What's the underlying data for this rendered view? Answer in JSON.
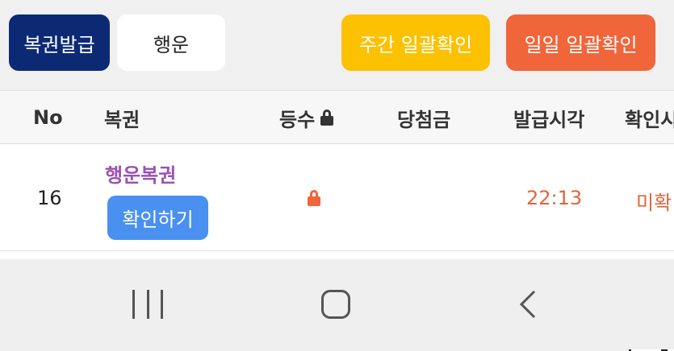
{
  "toolbar": {
    "issue_label": "복권발급",
    "luck_label": "행운",
    "weekly_label": "주간 일괄확인",
    "daily_label": "일일 일괄확인"
  },
  "table": {
    "headers": {
      "no": "No",
      "ticket": "복권",
      "rank": "등수",
      "prize": "당첨금",
      "time": "발급시각",
      "check": "확인시"
    },
    "rows": [
      {
        "no": "16",
        "ticket": "행운복권",
        "confirm_label": "확인하기",
        "rank_icon": "lock-icon",
        "prize": "",
        "time": "22:13",
        "status": "미확"
      }
    ]
  },
  "colors": {
    "issue_bg": "#0c2a74",
    "weekly_bg": "#fcc100",
    "daily_bg": "#f0653a",
    "ticket_text": "#9a52b2",
    "confirm_bg": "#4a90f0",
    "accent_text": "#e0653a"
  },
  "navbar": {
    "icons": [
      "recent-apps-icon",
      "home-icon",
      "back-icon"
    ]
  }
}
